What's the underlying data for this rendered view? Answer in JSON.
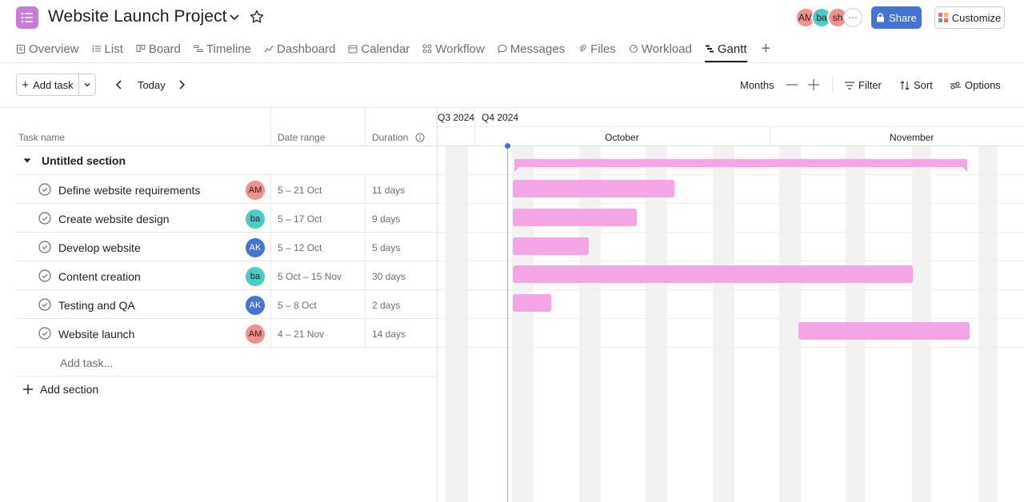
{
  "project": {
    "title": "Website Launch Project"
  },
  "members": [
    {
      "initials": "AM",
      "color": "#f1908f"
    },
    {
      "initials": "ba",
      "color": "#4ecbc4"
    },
    {
      "initials": "sh",
      "color": "#f1908f"
    },
    {
      "initials": "⋯",
      "color": "#ffffff"
    }
  ],
  "actions": {
    "share": "Share",
    "customize": "Customize"
  },
  "tabs": [
    {
      "label": "Overview",
      "icon": "clipboard-icon"
    },
    {
      "label": "List",
      "icon": "list-icon"
    },
    {
      "label": "Board",
      "icon": "board-icon"
    },
    {
      "label": "Timeline",
      "icon": "timeline-icon"
    },
    {
      "label": "Dashboard",
      "icon": "dashboard-icon"
    },
    {
      "label": "Calendar",
      "icon": "calendar-icon"
    },
    {
      "label": "Workflow",
      "icon": "workflow-icon"
    },
    {
      "label": "Messages",
      "icon": "message-icon"
    },
    {
      "label": "Files",
      "icon": "paperclip-icon"
    },
    {
      "label": "Workload",
      "icon": "workload-icon"
    },
    {
      "label": "Gantt",
      "icon": "gantt-icon",
      "active": true
    }
  ],
  "toolbar": {
    "add_task": "Add task",
    "today": "Today",
    "zoom": "Months",
    "filter": "Filter",
    "sort": "Sort",
    "options": "Options"
  },
  "columns": {
    "name": "Task name",
    "range": "Date range",
    "duration": "Duration"
  },
  "section": {
    "name": "Untitled section"
  },
  "tasks": [
    {
      "name": "Define website requirements",
      "assignee": "AM",
      "assignee_color": "#f1908f",
      "range": "5 – 21 Oct",
      "duration": "11 days"
    },
    {
      "name": "Create website design",
      "assignee": "ba",
      "assignee_color": "#4ecbc4",
      "range": "5 – 17 Oct",
      "duration": "9 days"
    },
    {
      "name": "Develop website",
      "assignee": "AK",
      "assignee_color": "#4573d2",
      "range": "5 – 12 Oct",
      "duration": "5 days"
    },
    {
      "name": "Content creation",
      "assignee": "ba",
      "assignee_color": "#4ecbc4",
      "range": "5 Oct – 15 Nov",
      "duration": "30 days"
    },
    {
      "name": "Testing and QA",
      "assignee": "AK",
      "assignee_color": "#4573d2",
      "range": "5 – 8 Oct",
      "duration": "2 days"
    },
    {
      "name": "Website launch",
      "assignee": "AM",
      "assignee_color": "#f1908f",
      "range": "4 – 21 Nov",
      "duration": "14 days"
    }
  ],
  "add_task_inline": "Add task...",
  "add_section": "Add section",
  "gantt": {
    "quarters": [
      "Q3 2024",
      "Q4 2024"
    ],
    "months": [
      "October",
      "November"
    ],
    "bar_color": "#f5a5e6"
  }
}
